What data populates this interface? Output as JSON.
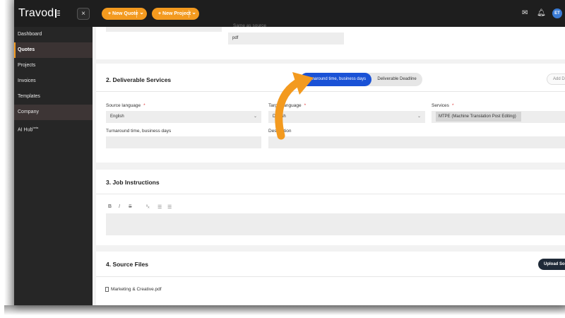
{
  "app": {
    "logo_text": "Travod",
    "close_label": "×"
  },
  "header": {
    "new_quote_label": "+ New Quote",
    "new_project_label": "+ New Project",
    "avatar_initials": "ET"
  },
  "sidebar": {
    "items": [
      {
        "label": "Dashboard"
      },
      {
        "label": "Quotes"
      },
      {
        "label": "Projects"
      },
      {
        "label": "Invoices"
      },
      {
        "label": "Templates"
      },
      {
        "label": "Company"
      },
      {
        "label": "AI Hub",
        "badge": "beta"
      }
    ]
  },
  "top_section": {
    "partial_label": "Same as source",
    "format_value": "pdf"
  },
  "deliverables": {
    "title": "2. Deliverable Services",
    "toggle_active": "Turnaround time, business days",
    "toggle_inactive": "Deliverable Deadline",
    "add_button": "Add De",
    "source_language_label": "Source language",
    "source_language_value": "English",
    "target_language_label": "Target language",
    "target_language_value": "Danish",
    "services_label": "Services",
    "services_value": "MTPE (Machine Translation Post Editing)",
    "turnaround_label": "Turnaround time, business days",
    "description_label": "Description"
  },
  "instructions": {
    "title": "3. Job Instructions",
    "toolbar": [
      "B",
      "I",
      "S",
      "ˣₓ",
      "☰",
      "☰"
    ]
  },
  "source_files": {
    "title": "4. Source Files",
    "upload_button": "Upload Sou",
    "file_name": "Marketing & Creative.pdf"
  },
  "colors": {
    "accent": "#f39a1f",
    "primary": "#1a52d6",
    "dark": "#1e1e1e"
  }
}
